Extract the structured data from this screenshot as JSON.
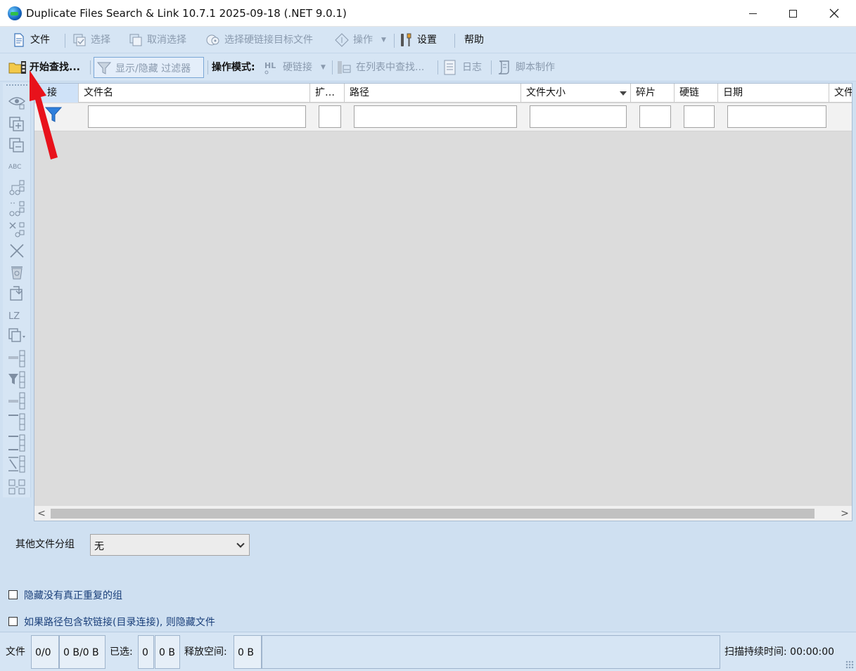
{
  "window": {
    "title": "Duplicate Files Search & Link 10.7.1 2025-09-18 (.NET 9.0.1)",
    "minimize_icon": "minimize-icon",
    "maximize_icon": "maximize-icon",
    "close_icon": "close-icon"
  },
  "menu": {
    "file": "文件",
    "select": "选择",
    "deselect": "取消选择",
    "select_hardlink_target": "选择硬链接目标文件",
    "operation": "操作",
    "settings": "设置",
    "help": "帮助"
  },
  "toolbar": {
    "start_search": "开始查找...",
    "show_hide_filter": "显示/隐藏 过滤器",
    "mode_label": "操作模式:",
    "hardlink": "硬链接",
    "find_in_list": "在列表中查找...",
    "log": "日志",
    "script": "脚本制作"
  },
  "grid": {
    "columns": [
      "链接",
      "文件名",
      "扩...",
      "路径",
      "文件大小",
      "碎片",
      "硬链",
      "日期",
      "文件"
    ],
    "first_col_visible": "接",
    "sorted_column": "文件大小",
    "ext_col_visible": "扩…",
    "last_col_visible": "文件"
  },
  "controls": {
    "other_group_label": "其他文件分组",
    "other_group_value": "无",
    "hide_no_true_duplicates": "隐藏没有真正重复的组",
    "hide_softlink_files": "如果路径包含软链接(目录连接), 则隐藏文件"
  },
  "status": {
    "files_label": "文件",
    "files_count": "0/0",
    "files_size": "0 B/0 B",
    "selected_label": "已选:",
    "selected_count": "0",
    "selected_size": "0 B",
    "freed_label": "释放空间:",
    "freed_size": "0 B",
    "scan_time": "扫描持续时间: 00:00:00"
  },
  "colors": {
    "background": "#cfe0f1",
    "toolbar": "#d6e5f4",
    "grid_empty": "#dcdcdc",
    "annotation_arrow": "#e8121b"
  }
}
